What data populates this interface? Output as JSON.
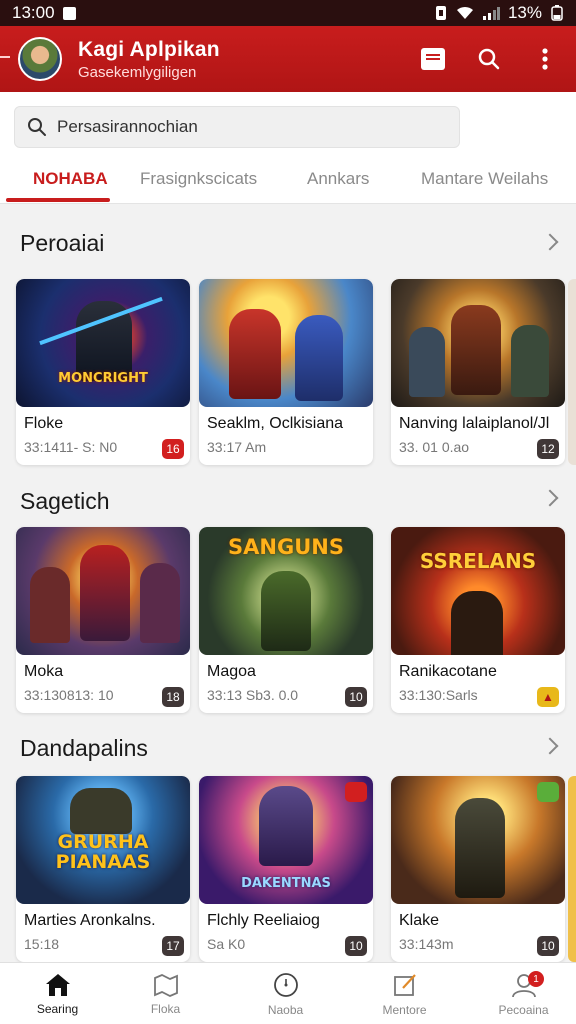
{
  "status": {
    "time": "13:00",
    "battery": "13%"
  },
  "app": {
    "title": "Kagi Aplpikan",
    "subtitle": "Gasekemlygiligen"
  },
  "search": {
    "placeholder": "Persasirannochian"
  },
  "tabs": [
    {
      "label": "NOHABA",
      "active": true
    },
    {
      "label": "Frasignkscicats",
      "active": false
    },
    {
      "label": "Annkars",
      "active": false
    },
    {
      "label": "Mantare Weilahs",
      "active": false
    }
  ],
  "sections": [
    {
      "title": "Peroaiai",
      "cards": [
        {
          "name": "Floke",
          "meta": "33:1411- S: N0",
          "badge": "16",
          "badge_red": true,
          "art_title": "MONCRIGHT"
        },
        {
          "name": "Seaklm, Oclkisiana",
          "meta": "33:17 Am",
          "badge": "",
          "badge_red": false,
          "art_title": ""
        },
        {
          "name": "Nanving lalaiplanol/Jl",
          "meta": "33. 01 0.ao",
          "badge": "12",
          "badge_red": false,
          "art_title": ""
        }
      ]
    },
    {
      "title": "Sagetich",
      "cards": [
        {
          "name": "Moka",
          "meta": "33:130813: 10",
          "badge": "18",
          "badge_red": false,
          "art_title": ""
        },
        {
          "name": "Magoa",
          "meta": "33:13 Sb3. 0.0",
          "badge": "10",
          "badge_red": false,
          "art_title": "SANGUNS"
        },
        {
          "name": "Ranikacotane",
          "meta": "33:130:Sarls",
          "badge": "",
          "badge_red": false,
          "art_title": "SSRELANS"
        }
      ]
    },
    {
      "title": "Dandapalins",
      "cards": [
        {
          "name": "Marties Aronkalns.",
          "meta": "15:18",
          "badge": "17",
          "badge_red": false,
          "art_title": "GRURHA PIANAAS"
        },
        {
          "name": "Flchly Reeliaiog",
          "meta": "Sa K0",
          "badge": "10",
          "badge_red": false,
          "art_title": "DAKENTNAS"
        },
        {
          "name": "Klake",
          "meta": "33:143m",
          "badge": "10",
          "badge_red": false,
          "art_title": ""
        }
      ]
    }
  ],
  "nav": [
    {
      "label": "Searing",
      "icon": "home-icon",
      "active": true
    },
    {
      "label": "Floka",
      "icon": "map-icon",
      "active": false
    },
    {
      "label": "Naoba",
      "icon": "clock-icon",
      "active": false
    },
    {
      "label": "Mentore",
      "icon": "edit-icon",
      "active": false
    },
    {
      "label": "Pecoaina",
      "icon": "user-icon",
      "active": false,
      "notification": "1"
    }
  ],
  "colors": {
    "primary": "#c81d1d",
    "background": "#f2f2f2"
  }
}
